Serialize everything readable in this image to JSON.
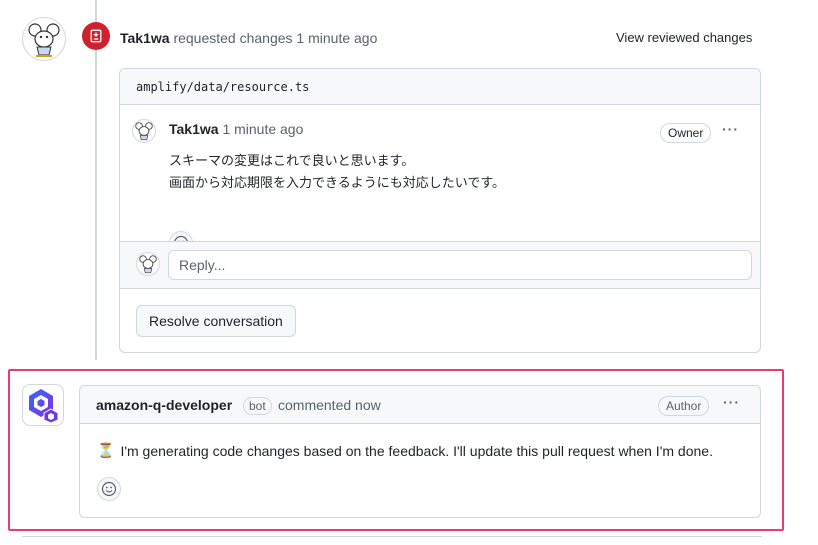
{
  "review": {
    "author": "Tak1wa",
    "action": "requested changes",
    "time": "1 minute ago",
    "view_changes_label": "View reviewed changes",
    "state_color": "#cf222e"
  },
  "file": {
    "path": "amplify/data/resource.ts"
  },
  "comment": {
    "author": "Tak1wa",
    "time": "1 minute ago",
    "badge": "Owner",
    "menu_icon": "···",
    "lines": [
      "スキーマの変更はこれで良いと思います。",
      "画面から対応期限を入力できるようにも対応したいです。"
    ],
    "reaction_icon": "smiley-icon"
  },
  "reply": {
    "placeholder": "Reply..."
  },
  "resolve_button": "Resolve conversation",
  "bot_comment": {
    "author": "amazon-q-developer",
    "bot_tag": "bot",
    "action": "commented now",
    "badge": "Author",
    "menu_icon": "···",
    "body_icon": "⏳",
    "body": "I'm generating code changes based on the feedback. I'll update this pull request when I'm done.",
    "reaction_icon": "smiley-icon"
  },
  "colors": {
    "highlight": "#ec3a72",
    "border": "#d0d7de",
    "muted": "#59636e",
    "danger": "#cf222e"
  }
}
